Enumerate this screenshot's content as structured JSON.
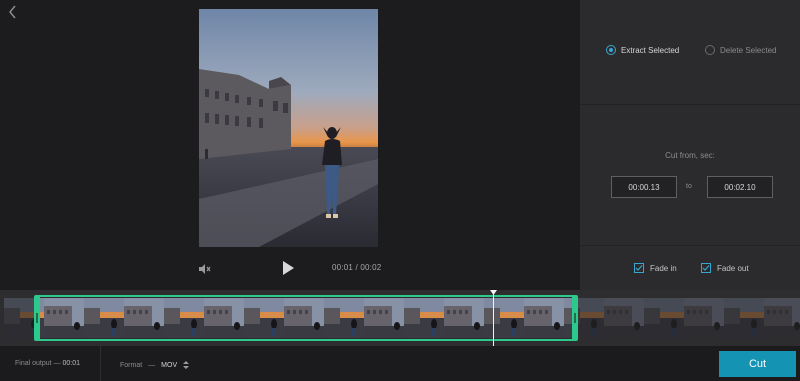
{
  "player": {
    "timecode_current": "00:01",
    "timecode_separator": "/",
    "timecode_total": "00:02"
  },
  "panel": {
    "mode_options": [
      {
        "label": "Extract Selected",
        "selected": true
      },
      {
        "label": "Delete Selected",
        "selected": false
      }
    ],
    "cut_from_label": "Cut from, sec:",
    "start_time": "00:00.13",
    "to_label": "to",
    "end_time": "00:02.10",
    "fade_in_label": "Fade in",
    "fade_in_checked": true,
    "fade_out_label": "Fade out",
    "fade_out_checked": true
  },
  "timeline": {
    "selection_start_fraction": 0.04,
    "selection_end_fraction": 0.72,
    "playhead_fraction": 0.615
  },
  "bottombar": {
    "final_output_label": "Final output",
    "final_output_dash": "—",
    "final_output_value": "00:01",
    "format_label": "Format",
    "format_dash": "—",
    "format_value": "MOV",
    "cut_button_label": "Cut"
  },
  "colors": {
    "accent": "#1593b3",
    "selection": "#2dc88b",
    "radio_accent": "#37a7d0"
  },
  "icons": [
    "back-chevron-icon",
    "mute-icon",
    "play-icon",
    "sort-arrows-icon",
    "check-icon"
  ]
}
